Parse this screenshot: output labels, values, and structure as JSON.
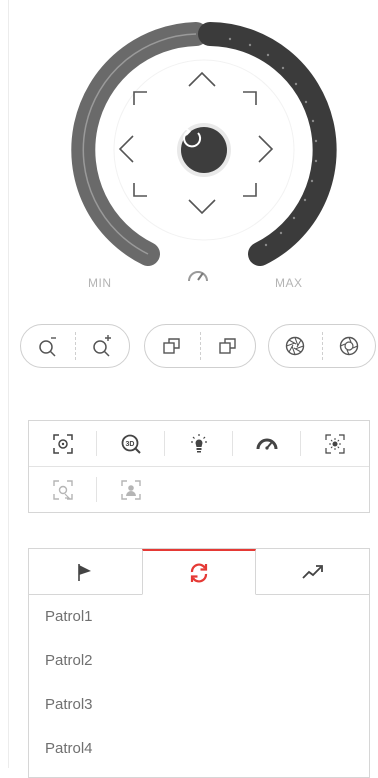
{
  "ptz": {
    "zoom_min_label": "MIN",
    "zoom_max_label": "MAX",
    "directions": [
      "up",
      "down",
      "left",
      "right",
      "up-left",
      "up-right",
      "down-left",
      "down-right"
    ],
    "center_icon": "refresh-icon",
    "speed_icon": "speedometer-icon"
  },
  "controls": {
    "zoom": [
      "zoom-out-icon",
      "zoom-in-icon"
    ],
    "focus": [
      "focus-near-icon",
      "focus-far-icon"
    ],
    "iris": [
      "iris-close-icon",
      "iris-open-icon"
    ]
  },
  "tools": {
    "row1": [
      "region-focus-icon",
      "3d-zoom-icon",
      "light-icon",
      "speed-icon",
      "wiper-icon"
    ],
    "row2": [
      "auto-focus-icon",
      "lens-init-icon"
    ]
  },
  "tabs": [
    "preset-icon",
    "patrol-icon",
    "pattern-icon"
  ],
  "active_tab": "patrol",
  "patrols": [
    "Patrol1",
    "Patrol2",
    "Patrol3",
    "Patrol4"
  ],
  "colors": {
    "accent": "#e53935",
    "dial_dark": "#3b3b3b",
    "dial_grey": "#666666"
  }
}
